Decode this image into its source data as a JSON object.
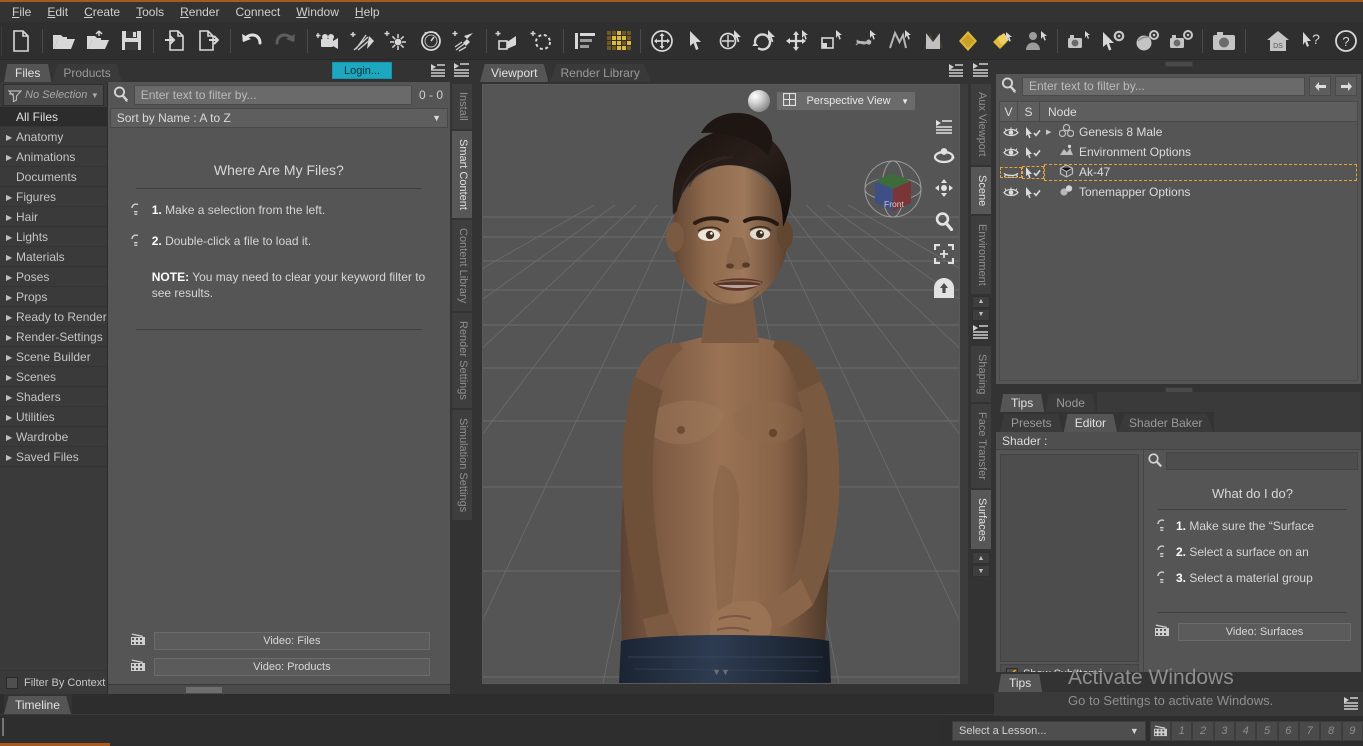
{
  "app": {
    "title": "DAZ Studio"
  },
  "menubar": {
    "items": [
      "File",
      "Edit",
      "Create",
      "Tools",
      "Render",
      "Connect",
      "Window",
      "Help"
    ]
  },
  "toolbar": {
    "groups": [
      {
        "items": [
          {
            "name": "new-file-icon",
            "label": "New"
          },
          {
            "name": "open-file-icon",
            "label": "Open"
          },
          {
            "name": "open-recent-icon",
            "label": "Open Recent"
          },
          {
            "name": "save-icon",
            "label": "Save"
          },
          {
            "name": "import-icon",
            "label": "Import"
          },
          {
            "name": "export-icon",
            "label": "Export"
          }
        ]
      },
      {
        "items": [
          {
            "name": "undo-icon",
            "label": "Undo"
          },
          {
            "name": "redo-icon",
            "label": "Redo"
          }
        ]
      },
      {
        "items": [
          {
            "name": "create-camera-icon",
            "label": "Create Camera"
          },
          {
            "name": "create-distant-light-icon",
            "label": "Create Distant Light"
          },
          {
            "name": "create-point-light-icon",
            "label": "Create Point Light"
          },
          {
            "name": "create-linear-light-icon",
            "label": "Create Linear Point Light"
          },
          {
            "name": "create-spot-light-icon",
            "label": "Create Spot Light"
          }
        ]
      },
      {
        "items": [
          {
            "name": "create-primitive-icon",
            "label": "Create Primitive"
          },
          {
            "name": "create-null-icon",
            "label": "Create Null"
          }
        ]
      },
      {
        "items": [
          {
            "name": "layers-icon",
            "label": "Layers"
          }
        ]
      },
      {
        "items": [
          {
            "name": "render-settings-grid-icon",
            "label": "Render"
          },
          {
            "name": "universal-manipulator-icon",
            "label": "Universal Manipulator"
          },
          {
            "name": "node-selection-tool-icon",
            "label": "Node Selection Tool"
          },
          {
            "name": "rotate-tool-icon",
            "label": "Rotate Tool"
          },
          {
            "name": "spin-tool-icon",
            "label": "Spin Tool"
          },
          {
            "name": "translate-tool-icon",
            "label": "Translate Tool"
          },
          {
            "name": "scale-tool-icon",
            "label": "Scale Tool"
          },
          {
            "name": "joint-editor-tool-icon",
            "label": "Joint Editor Tool"
          },
          {
            "name": "mesh-grabber-tool-icon",
            "label": "Mesh Grabber"
          },
          {
            "name": "surface-selection-tool-icon",
            "label": "Surface Selection Tool"
          },
          {
            "name": "figure-setup-icon",
            "label": "Figure Setup"
          },
          {
            "name": "camera-tool-icon",
            "label": "Camera Tool"
          }
        ]
      },
      {
        "items": [
          {
            "name": "puppeteer-tool-icon",
            "label": "Puppeteer"
          },
          {
            "name": "geometry-editor-icon",
            "label": "Geometry Editor"
          },
          {
            "name": "render-camera-settings-icon",
            "label": "Render Settings"
          },
          {
            "name": "render-icon",
            "label": "Render"
          }
        ]
      },
      {
        "items": [
          {
            "name": "daz-studio-home-icon",
            "label": "DS Home"
          },
          {
            "name": "context-help-icon",
            "label": "Context Help"
          },
          {
            "name": "help-icon",
            "label": "Help"
          }
        ]
      }
    ]
  },
  "left_dock": {
    "tabs": [
      {
        "label": "Files",
        "active": true
      },
      {
        "label": "Products",
        "active": false
      }
    ],
    "login_label": "Login...",
    "category_filter": "No Selection",
    "categories": [
      {
        "label": "All Files",
        "expandable": false,
        "selected": true
      },
      {
        "label": "Anatomy",
        "expandable": true,
        "selected": false
      },
      {
        "label": "Animations",
        "expandable": true,
        "selected": false
      },
      {
        "label": "Documents",
        "expandable": false,
        "selected": false
      },
      {
        "label": "Figures",
        "expandable": true,
        "selected": false
      },
      {
        "label": "Hair",
        "expandable": true,
        "selected": false
      },
      {
        "label": "Lights",
        "expandable": true,
        "selected": false
      },
      {
        "label": "Materials",
        "expandable": true,
        "selected": false
      },
      {
        "label": "Poses",
        "expandable": true,
        "selected": false
      },
      {
        "label": "Props",
        "expandable": true,
        "selected": false
      },
      {
        "label": "Ready to Render",
        "expandable": true,
        "selected": false
      },
      {
        "label": "Render-Settings",
        "expandable": true,
        "selected": false
      },
      {
        "label": "Scene Builder",
        "expandable": true,
        "selected": false
      },
      {
        "label": "Scenes",
        "expandable": true,
        "selected": false
      },
      {
        "label": "Shaders",
        "expandable": true,
        "selected": false
      },
      {
        "label": "Utilities",
        "expandable": true,
        "selected": false
      },
      {
        "label": "Wardrobe",
        "expandable": true,
        "selected": false
      },
      {
        "label": "Saved Files",
        "expandable": true,
        "selected": false
      }
    ],
    "filter_by_context_label": "Filter By Context",
    "filter_by_context_checked": false,
    "search_placeholder": "Enter text to filter by...",
    "search_value": "",
    "result_count": "0 - 0",
    "sort_label": "Sort by Name : A to Z",
    "tips": {
      "title": "Where Are My Files?",
      "steps": [
        {
          "num": "1.",
          "text": "Make a selection from the left."
        },
        {
          "num": "2.",
          "text": "Double-click a file to load it."
        }
      ],
      "note_label": "NOTE:",
      "note_text": "You may need to clear your keyword filter to see results.",
      "video_buttons": [
        "Video: Files",
        "Video:  Products"
      ]
    }
  },
  "left_vtabs": [
    {
      "label": "Install",
      "active": false
    },
    {
      "label": "Smart Content",
      "active": true
    },
    {
      "label": "Content Library",
      "active": false
    },
    {
      "label": "Render Settings",
      "active": false
    },
    {
      "label": "Simulation Settings",
      "active": false
    }
  ],
  "right_vtabs": [
    {
      "label": "Aux Viewport",
      "active": false
    },
    {
      "label": "Scene",
      "active": true
    },
    {
      "label": "Environment",
      "active": false
    },
    {
      "label": "Shaping",
      "active": false
    },
    {
      "label": "Face Transfer",
      "active": false
    },
    {
      "label": "Surfaces",
      "active": true
    }
  ],
  "viewport": {
    "tabs": [
      {
        "label": "Viewport",
        "active": true
      },
      {
        "label": "Render Library",
        "active": false
      }
    ],
    "view_label": "Perspective View",
    "cube_face_label": "Front",
    "nav_icons": [
      {
        "name": "viewport-options-icon"
      },
      {
        "name": "orbit-camera-icon"
      },
      {
        "name": "pan-camera-icon"
      },
      {
        "name": "zoom-camera-icon"
      },
      {
        "name": "frame-selection-icon"
      },
      {
        "name": "reset-camera-icon"
      }
    ]
  },
  "scene_panel": {
    "search_placeholder": "Enter text to filter by...",
    "search_value": "",
    "columns": [
      "V",
      "S",
      "Node"
    ],
    "nodes": [
      {
        "name": "Genesis 8 Male",
        "icon": "figure-icon",
        "expandable": true,
        "visible": true,
        "selectable": true,
        "selected": false
      },
      {
        "name": "Environment Options",
        "icon": "environment-icon",
        "expandable": false,
        "visible": true,
        "selectable": true,
        "selected": false
      },
      {
        "name": "Ak-47",
        "icon": "prop-cube-icon",
        "expandable": false,
        "visible": false,
        "selectable": true,
        "selected": true
      },
      {
        "name": "Tonemapper Options",
        "icon": "tonemapper-icon",
        "expandable": false,
        "visible": true,
        "selectable": true,
        "selected": false
      }
    ]
  },
  "surfaces_panel": {
    "outer_tabs": [
      {
        "label": "Tips",
        "active": true
      },
      {
        "label": "Node",
        "active": false
      }
    ],
    "inner_tabs": [
      {
        "label": "Presets",
        "active": false
      },
      {
        "label": "Editor",
        "active": true
      },
      {
        "label": "Shader Baker",
        "active": false
      }
    ],
    "shader_label": "Shader :",
    "show_sub_items_label": "Show Sub Items",
    "show_sub_items_checked": true,
    "search_value": "",
    "tips": {
      "title": "What do I do?",
      "steps": [
        {
          "num": "1.",
          "text": "Make sure the “Surface"
        },
        {
          "num": "2.",
          "text": "Select a surface on an"
        },
        {
          "num": "3.",
          "text": "Select a material group"
        }
      ],
      "video_button": "Video: Surfaces"
    }
  },
  "bottom_tips": {
    "tabs": [
      {
        "label": "Tips",
        "active": true
      }
    ]
  },
  "timeline": {
    "tabs": [
      {
        "label": "Timeline",
        "active": true
      }
    ]
  },
  "lesson_bar": {
    "select_label": "Select a Lesson...",
    "film_icon": "film-strip-icon",
    "numbers": [
      "1",
      "2",
      "3",
      "4",
      "5",
      "6",
      "7",
      "8",
      "9"
    ]
  },
  "watermark": {
    "line1": "Activate Windows",
    "line2": "Go to Settings to activate Windows."
  },
  "colors": {
    "accent_orange": "#e8a33d",
    "login_teal": "#1da8c0",
    "window_bg": "#333333",
    "panel_bg": "#555555",
    "edge_orange": "#a85a1e"
  }
}
